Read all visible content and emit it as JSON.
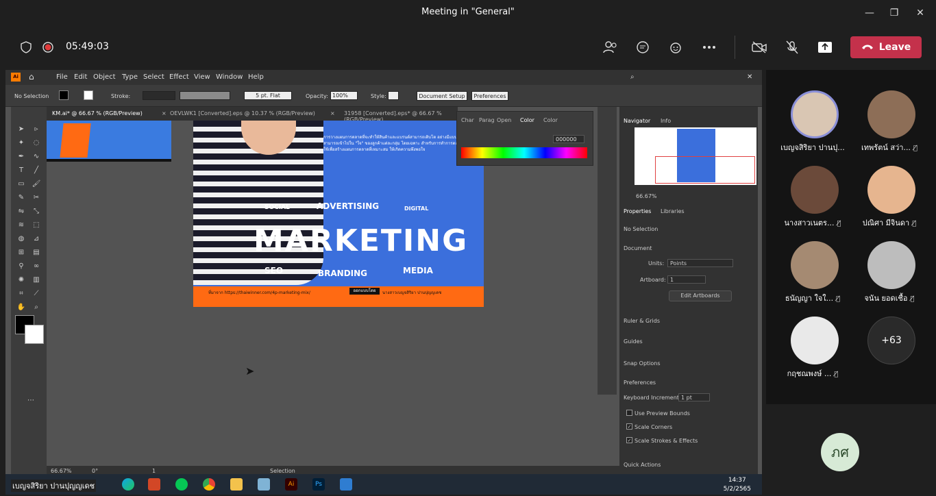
{
  "window": {
    "title": "Meeting in \"General\""
  },
  "meeting": {
    "timer": "05:49:03",
    "leave_label": "Leave"
  },
  "illustrator": {
    "menu": [
      "File",
      "Edit",
      "Object",
      "Type",
      "Select",
      "Effect",
      "View",
      "Window",
      "Help"
    ],
    "control": {
      "selection": "No Selection",
      "stroke_label": "Stroke:",
      "brush": "5 pt. Flat",
      "opacity_label": "Opacity:",
      "opacity": "100%",
      "style_label": "Style:",
      "document_setup": "Document Setup",
      "preferences": "Preferences"
    },
    "tabs": [
      "KM.ai* @ 66.67 % (RGB/Preview)",
      "OEVLWK1 [Converted].eps @ 10.37 % (RGB/Preview)",
      "31958 [Converted].eps* @ 66.67 % (RGB/Preview)"
    ],
    "color_panel": {
      "tabs": [
        "Char",
        "Parag",
        "Open",
        "Color",
        "Color"
      ],
      "hex": "000000"
    },
    "poster": {
      "title": "MARKETING",
      "words": [
        "SOCIAL",
        "ADVERTISING",
        "DIGITAL",
        "SEO",
        "BRANDING",
        "MEDIA"
      ],
      "body": "การวางแผนการตลาดที่จะทำให้สินค้าและแบรนด์สามารถเติบโต อย่างมีแบบแผน และสามารถเข้าไปใน \"ใจ\" ของลูกค้าแต่ละกลุ่ม โดยเฉพาะ สำหรับการทำการตลาด 4P มีไว้ใช้เพื่อสร้างแผนการตลาดที่เหมาะสม ให้เกิดความพึงพอใจ",
      "footer_url": "ที่มาจาก https://thaiwinner.com/4p-marketing-mix/",
      "badge": "ออกแบบโดย",
      "footer_author": "นางสาวเบญจสิริยา ปานปุญญเดช"
    },
    "navigator": {
      "tabs": [
        "Navigator",
        "Info"
      ],
      "zoom": "66.67%"
    },
    "properties": {
      "tabs": [
        "Properties",
        "Libraries"
      ],
      "selection": "No Selection",
      "document": "Document",
      "units_label": "Units:",
      "units": "Points",
      "artboard_label": "Artboard:",
      "artboard": "1",
      "edit_artboards": "Edit Artboards",
      "ruler_grids": "Ruler & Grids",
      "guides": "Guides",
      "snap_options": "Snap Options",
      "preferences": "Preferences",
      "keyboard_increment_label": "Keyboard Increment:",
      "keyboard_increment": "1 pt",
      "use_preview_bounds": "Use Preview Bounds",
      "scale_corners": "Scale Corners",
      "scale_strokes": "Scale Strokes & Effects",
      "quick_actions": "Quick Actions"
    },
    "status": {
      "zoom": "66.67%",
      "rotate": "0°",
      "artboard": "1",
      "tool": "Selection"
    }
  },
  "taskbar": {
    "presenter": "เบญจสิริยา ปานปุญญเดช",
    "time": "14:37",
    "date": "5/2/2565"
  },
  "participants": [
    {
      "name": "เบญจสิริยา ปานปุ...",
      "muted": false,
      "color": "#d9c6b3"
    },
    {
      "name": "เทพรัตน์ สว่า...",
      "muted": true,
      "color": "#8d6e57"
    },
    {
      "name": "นางสาวเนตร...",
      "muted": true,
      "color": "#6b4a3a"
    },
    {
      "name": "ปณิศา มีจินดา",
      "muted": true,
      "color": "#e6b58f"
    },
    {
      "name": "ธนัญญา ใจใ...",
      "muted": true,
      "color": "#a58a72"
    },
    {
      "name": "จนัน ยอดเชื้อ",
      "muted": true,
      "color": "#bdbdbd"
    },
    {
      "name": "กฤชณพงษ์ ...",
      "muted": true,
      "color": "#e9e9e9"
    }
  ],
  "more_participants": "+63",
  "self_initials": "ภศ"
}
